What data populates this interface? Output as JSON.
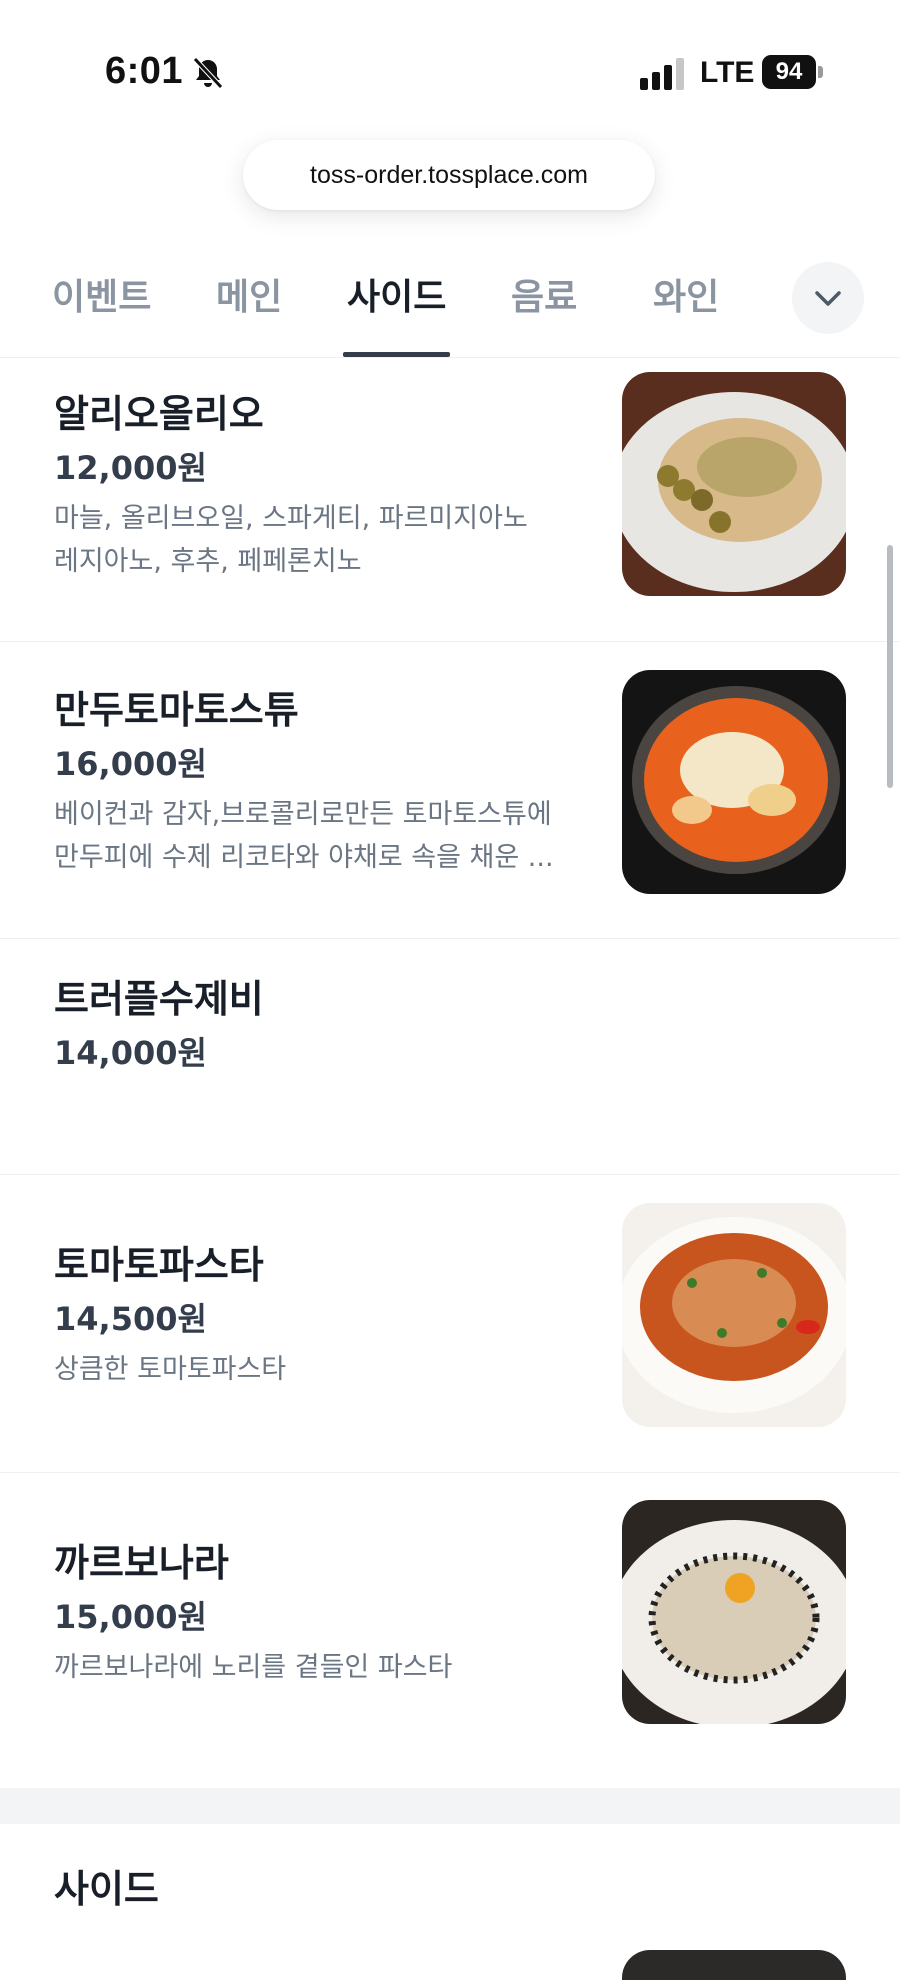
{
  "status_bar": {
    "time": "6:01",
    "network": "LTE",
    "battery": "94"
  },
  "browser": {
    "url": "toss-order.tossplace.com"
  },
  "tabs": [
    {
      "label": "이벤트",
      "active": false
    },
    {
      "label": "메인",
      "active": false
    },
    {
      "label": "사이드",
      "active": true
    },
    {
      "label": "음료",
      "active": false
    },
    {
      "label": "와인",
      "active": false
    }
  ],
  "menu": {
    "items": [
      {
        "name": "알리오올리오",
        "price": "12,000원",
        "desc1": "마늘, 올리브오일, 스파게티, 파르미지아노",
        "desc2": "레지아노, 후추, 페페론치노",
        "image": "aglio-olio-photo"
      },
      {
        "name": "만두토마토스튜",
        "price": "16,000원",
        "desc1": "베이컨과 감자,브로콜리로만든 토마토스튜에",
        "desc2": "만두피에 수제 리코타와 야채로 속을 채운 ...",
        "image": "tomato-stew-photo"
      },
      {
        "name": "트러플수제비",
        "price": "14,000원",
        "desc1": "",
        "desc2": ""
      },
      {
        "name": "토마토파스타",
        "price": "14,500원",
        "desc1": "상큼한 토마토파스타",
        "desc2": "",
        "image": "tomato-pasta-photo"
      },
      {
        "name": "까르보나라",
        "price": "15,000원",
        "desc1": "까르보나라에 노리를 곁들인 파스타",
        "desc2": "",
        "image": "carbonara-photo"
      }
    ]
  },
  "next_section": {
    "title": "사이드"
  },
  "colors": {
    "text": "#191f28",
    "sub_text": "#6b7684",
    "inactive_tab": "#8b95a1",
    "divider": "#eef0f2"
  }
}
